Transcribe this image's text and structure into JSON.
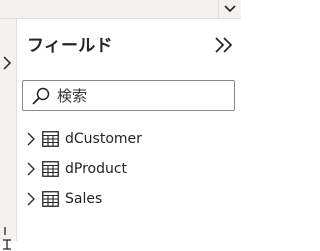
{
  "panel": {
    "title": "フィールド",
    "collapse_icon": "double-chevron-right-icon"
  },
  "search": {
    "placeholder": "検索",
    "value": "",
    "icon": "search-icon"
  },
  "fields": [
    {
      "label": "dCustomer",
      "icon": "table-icon",
      "expand_icon": "chevron-right-icon"
    },
    {
      "label": "dProduct",
      "icon": "table-icon",
      "expand_icon": "chevron-right-icon"
    },
    {
      "label": "Sales",
      "icon": "table-icon",
      "expand_icon": "chevron-right-icon"
    }
  ],
  "colors": {
    "text": "#252423",
    "border": "#8a8886",
    "chrome": "#f3f2f1"
  }
}
